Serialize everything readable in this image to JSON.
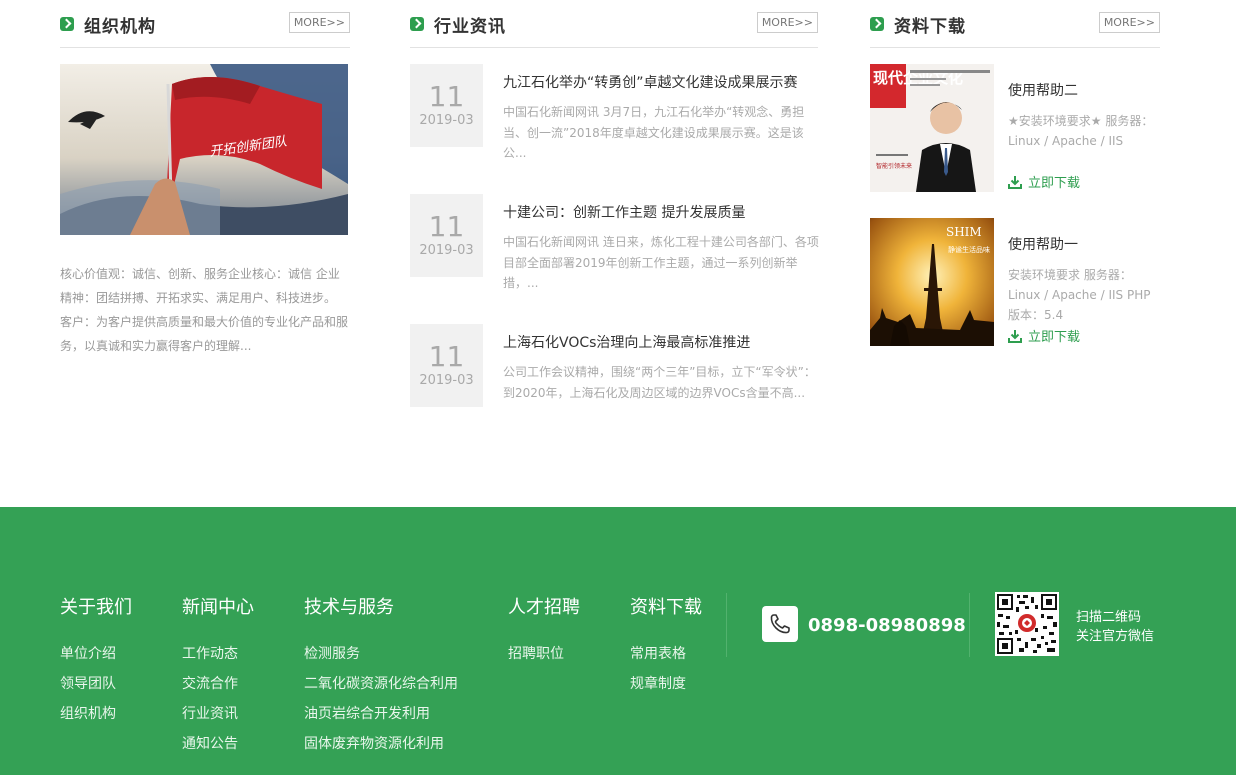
{
  "org": {
    "title": "组织机构",
    "more": "MORE>>",
    "image_flag_text": "开拓创新团队",
    "text": "核心价值观：诚信、创新、服务企业核心：诚信 企业精神：团结拼搏、开拓求实、满足用户、科技进步。 客户：为客户提供高质量和最大价值的专业化产品和服务，以真诚和实力赢得客户的理解..."
  },
  "news": {
    "title": "行业资讯",
    "more": "MORE>>",
    "items": [
      {
        "day": "11",
        "ym": "2019-03",
        "title": "九江石化举办“转勇创”卓越文化建设成果展示赛",
        "desc": "中国石化新闻网讯 3月7日，九江石化举办“转观念、勇担当、创一流”2018年度卓越文化建设成果展示赛。这是该公..."
      },
      {
        "day": "11",
        "ym": "2019-03",
        "title": "十建公司：创新工作主题 提升发展质量",
        "desc": "中国石化新闻网讯 连日来，炼化工程十建公司各部门、各项目部全面部署2019年创新工作主题，通过一系列创新举措，..."
      },
      {
        "day": "11",
        "ym": "2019-03",
        "title": "上海石化VOCs治理向上海最高标准推进",
        "desc": "公司工作会议精神，围绕“两个三年”目标，立下“军令状”：到2020年，上海石化及周边区域的边界VOCs含量不高..."
      }
    ]
  },
  "downloads": {
    "title": "资料下载",
    "more": "MORE>>",
    "items": [
      {
        "title": "使用帮助二",
        "desc": "★安装环境要求★ 服务器：Linux / Apache / IIS",
        "link": "立即下载",
        "thumb_title": "现代企业文化",
        "thumb_caption": "智能引领未来"
      },
      {
        "title": "使用帮助一",
        "desc": "安装环境要求 服务器：Linux / Apache / IIS PHP版本：5.4",
        "link": "立即下载",
        "thumb_title": "SHIM",
        "thumb_caption": "静谧生活品味"
      }
    ]
  },
  "footer": {
    "columns": [
      {
        "title": "关于我们",
        "links": [
          "单位介绍",
          "领导团队",
          "组织机构"
        ]
      },
      {
        "title": "新闻中心",
        "links": [
          "工作动态",
          "交流合作",
          "行业资讯",
          "通知公告"
        ]
      },
      {
        "title": "技术与服务",
        "links": [
          "检测服务",
          "二氧化碳资源化综合利用",
          "油页岩综合开发利用",
          "固体废弃物资源化利用"
        ]
      },
      {
        "title": "人才招聘",
        "links": [
          "招聘职位"
        ]
      },
      {
        "title": "资料下载",
        "links": [
          "常用表格",
          "规章制度"
        ]
      }
    ],
    "phone": "0898-08980898",
    "qr_line1": "扫描二维码",
    "qr_line2": "关注官方微信"
  },
  "colors": {
    "brand_green": "#34a155",
    "accent_green": "#2e9e4f"
  },
  "icons": [
    "arrow-right-icon",
    "download-icon",
    "phone-icon",
    "qr-code"
  ]
}
